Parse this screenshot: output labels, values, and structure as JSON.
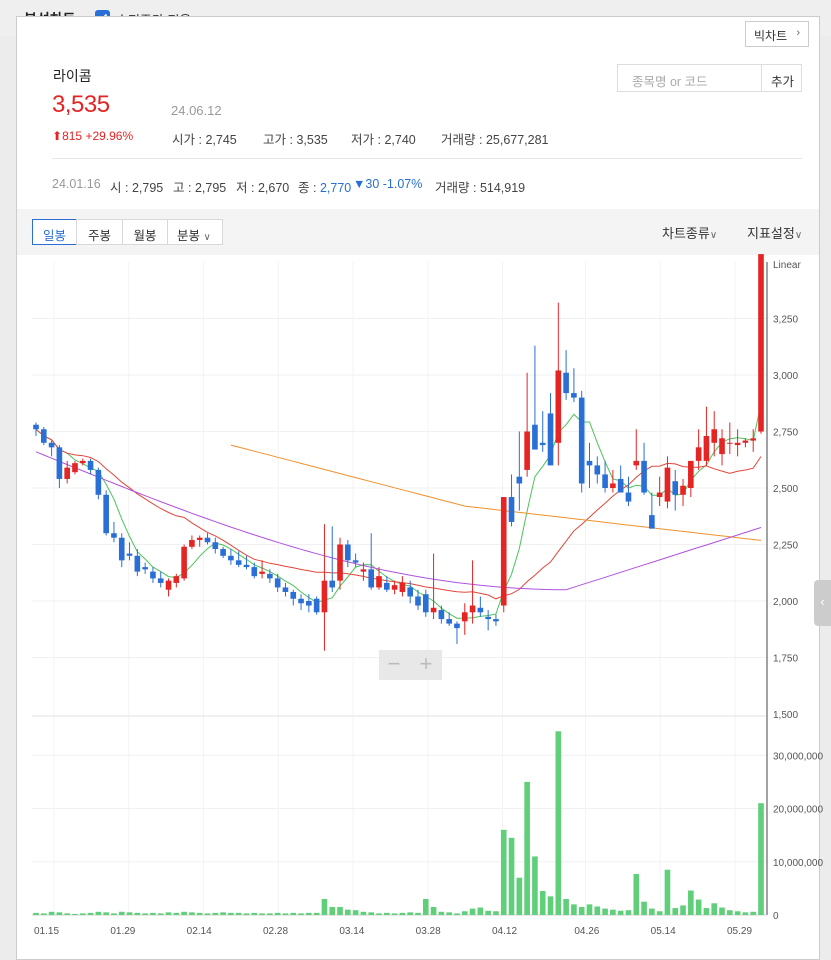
{
  "header": {
    "title": "분석차트",
    "adjusted_price_label": "수정주가 적용",
    "adjusted_price_checked": true,
    "big_chart_label": "빅차트"
  },
  "stock": {
    "name": "라이콤",
    "price": "3,535",
    "date": "24.06.12",
    "change": "815",
    "change_pct": "+29.96%",
    "open_label": "시가",
    "open": "2,745",
    "high_label": "고가",
    "high": "3,535",
    "low_label": "저가",
    "low": "2,740",
    "volume_label": "거래량",
    "volume": "25,677,281"
  },
  "search": {
    "placeholder": "종목명 or 코드",
    "add_label": "추가"
  },
  "reference": {
    "date": "24.01.16",
    "open_label": "시",
    "open": "2,795",
    "high_label": "고",
    "high": "2,795",
    "low_label": "저",
    "low": "2,670",
    "close_label": "종",
    "close": "2,770",
    "change": "30",
    "change_pct": "-1.07%",
    "volume_label": "거래량",
    "volume": "514,919"
  },
  "tabs": [
    "일봉",
    "주봉",
    "월봉",
    "분봉"
  ],
  "active_tab": "일봉",
  "menus": {
    "chart_type": "차트종류",
    "indicator": "지표설정"
  },
  "colors": {
    "up": "#e52424",
    "down": "#2a6fd6",
    "ma5": "#4cc35a",
    "ma20": "#e2463a",
    "ma60": "#f0902c",
    "ma120": "#b052e0",
    "volume": "#5fcf7a"
  },
  "chart_data": {
    "type": "candlestick",
    "scale_label": "Linear",
    "price_ticks": [
      "3,250",
      "3,000",
      "2,750",
      "2,500",
      "2,250",
      "2,000",
      "1,750",
      "1,500"
    ],
    "price_range": [
      1500,
      3500
    ],
    "volume_ticks": [
      "30,000,000",
      "20,000,000",
      "10,000,000",
      "0"
    ],
    "volume_range": [
      0,
      37000000
    ],
    "x_labels": [
      "01.15",
      "01.29",
      "02.14",
      "02.28",
      "03.14",
      "03.28",
      "04.12",
      "04.26",
      "05.14",
      "05.29"
    ],
    "candles": [
      [
        2780,
        2790,
        2730,
        2760,
        400000
      ],
      [
        2760,
        2770,
        2690,
        2700,
        300000
      ],
      [
        2700,
        2710,
        2640,
        2680,
        600000
      ],
      [
        2680,
        2690,
        2500,
        2540,
        500000
      ],
      [
        2540,
        2620,
        2520,
        2590,
        300000
      ],
      [
        2570,
        2620,
        2560,
        2610,
        200000
      ],
      [
        2610,
        2630,
        2600,
        2620,
        300000
      ],
      [
        2620,
        2630,
        2560,
        2580,
        400000
      ],
      [
        2580,
        2590,
        2450,
        2470,
        600000
      ],
      [
        2470,
        2490,
        2290,
        2300,
        500000
      ],
      [
        2300,
        2350,
        2260,
        2280,
        300000
      ],
      [
        2280,
        2300,
        2150,
        2180,
        600000
      ],
      [
        2210,
        2260,
        2180,
        2200,
        500000
      ],
      [
        2200,
        2230,
        2110,
        2130,
        400000
      ],
      [
        2150,
        2170,
        2120,
        2140,
        300000
      ],
      [
        2130,
        2150,
        2080,
        2100,
        400000
      ],
      [
        2100,
        2130,
        2060,
        2080,
        300000
      ],
      [
        2050,
        2100,
        2020,
        2090,
        500000
      ],
      [
        2080,
        2120,
        2060,
        2110,
        400000
      ],
      [
        2100,
        2250,
        2090,
        2240,
        600000
      ],
      [
        2240,
        2290,
        2230,
        2270,
        500000
      ],
      [
        2270,
        2290,
        2240,
        2280,
        400000
      ],
      [
        2280,
        2300,
        2250,
        2260,
        300000
      ],
      [
        2260,
        2280,
        2210,
        2230,
        400000
      ],
      [
        2230,
        2240,
        2190,
        2200,
        500000
      ],
      [
        2200,
        2230,
        2160,
        2180,
        400000
      ],
      [
        2180,
        2220,
        2150,
        2160,
        400000
      ],
      [
        2160,
        2200,
        2140,
        2150,
        300000
      ],
      [
        2150,
        2170,
        2100,
        2110,
        400000
      ],
      [
        2120,
        2180,
        2100,
        2130,
        300000
      ],
      [
        2120,
        2140,
        2080,
        2100,
        300000
      ],
      [
        2100,
        2120,
        2040,
        2060,
        400000
      ],
      [
        2060,
        2080,
        2020,
        2040,
        300000
      ],
      [
        2040,
        2050,
        1980,
        2010,
        400000
      ],
      [
        2010,
        2030,
        1960,
        1990,
        300000
      ],
      [
        2000,
        2030,
        1950,
        1980,
        400000
      ],
      [
        2010,
        2020,
        1940,
        1950,
        400000
      ],
      [
        1950,
        2340,
        1780,
        2090,
        3000000
      ],
      [
        2090,
        2330,
        2040,
        2060,
        1500000
      ],
      [
        2090,
        2280,
        2050,
        2250,
        1500000
      ],
      [
        2250,
        2270,
        2150,
        2180,
        1000000
      ],
      [
        2180,
        2210,
        2150,
        2170,
        900000
      ],
      [
        2130,
        2170,
        2090,
        2140,
        600000
      ],
      [
        2140,
        2300,
        2050,
        2060,
        500000
      ],
      [
        2060,
        2150,
        2050,
        2110,
        300000
      ],
      [
        2080,
        2110,
        2040,
        2050,
        400000
      ],
      [
        2050,
        2090,
        2030,
        2070,
        300000
      ],
      [
        2040,
        2110,
        2020,
        2080,
        400000
      ],
      [
        2060,
        2090,
        1990,
        2020,
        500000
      ],
      [
        2020,
        2050,
        1960,
        1980,
        400000
      ],
      [
        2030,
        2050,
        1930,
        1950,
        3000000
      ],
      [
        1950,
        2210,
        1920,
        1970,
        1500000
      ],
      [
        1960,
        1980,
        1900,
        1920,
        600000
      ],
      [
        1920,
        1950,
        1890,
        1900,
        500000
      ],
      [
        1900,
        1910,
        1810,
        1880,
        300000
      ],
      [
        1910,
        1990,
        1850,
        1950,
        700000
      ],
      [
        1950,
        2180,
        1900,
        1980,
        1200000
      ],
      [
        1970,
        2020,
        1930,
        1950,
        1400000
      ],
      [
        1930,
        1960,
        1870,
        1920,
        800000
      ],
      [
        1920,
        1940,
        1890,
        1910,
        700000
      ],
      [
        1980,
        2460,
        1950,
        2460,
        16000000
      ],
      [
        2460,
        2560,
        2330,
        2350,
        14500000
      ],
      [
        2550,
        2750,
        2400,
        2520,
        7000000
      ],
      [
        2580,
        3010,
        2550,
        2750,
        25000000
      ],
      [
        2780,
        3130,
        2700,
        2670,
        11000000
      ],
      [
        2700,
        2840,
        2660,
        2690,
        4500000
      ],
      [
        2830,
        2920,
        2660,
        2600,
        3500000
      ],
      [
        2700,
        3320,
        2600,
        3020,
        34500000
      ],
      [
        3010,
        3110,
        2890,
        2920,
        3000000
      ],
      [
        2920,
        3030,
        2880,
        2900,
        2000000
      ],
      [
        2900,
        2930,
        2480,
        2520,
        1500000
      ],
      [
        2620,
        2700,
        2500,
        2600,
        2000000
      ],
      [
        2600,
        2640,
        2520,
        2560,
        1600000
      ],
      [
        2560,
        2620,
        2480,
        2500,
        1200000
      ],
      [
        2500,
        2580,
        2480,
        2520,
        1000000
      ],
      [
        2540,
        2600,
        2480,
        2480,
        800000
      ],
      [
        2480,
        2550,
        2420,
        2440,
        900000
      ],
      [
        2600,
        2760,
        2580,
        2620,
        7700000
      ],
      [
        2620,
        2700,
        2470,
        2480,
        2500000
      ],
      [
        2380,
        2480,
        2330,
        2320,
        1200000
      ],
      [
        2460,
        2550,
        2420,
        2480,
        700000
      ],
      [
        2440,
        2640,
        2410,
        2590,
        8500000
      ],
      [
        2530,
        2580,
        2400,
        2470,
        1300000
      ],
      [
        2470,
        2540,
        2420,
        2510,
        1800000
      ],
      [
        2500,
        2620,
        2460,
        2620,
        4600000
      ],
      [
        2620,
        2760,
        2580,
        2680,
        2900000
      ],
      [
        2620,
        2860,
        2600,
        2730,
        1300000
      ],
      [
        2700,
        2840,
        2640,
        2760,
        2200000
      ],
      [
        2650,
        2760,
        2600,
        2720,
        1400000
      ],
      [
        2700,
        2790,
        2650,
        2700,
        900000
      ],
      [
        2690,
        2760,
        2640,
        2700,
        700000
      ],
      [
        2700,
        2720,
        2680,
        2710,
        500000
      ],
      [
        2710,
        2760,
        2660,
        2720,
        600000
      ],
      [
        2750,
        3470,
        2740,
        3535,
        21000000
      ]
    ],
    "ma_lines": [
      {
        "name": "MA5",
        "color": "#4cc35a"
      },
      {
        "name": "MA20",
        "color": "#e2463a"
      },
      {
        "name": "MA60",
        "color": "#f0902c"
      },
      {
        "name": "MA120",
        "color": "#b052e0"
      }
    ]
  }
}
